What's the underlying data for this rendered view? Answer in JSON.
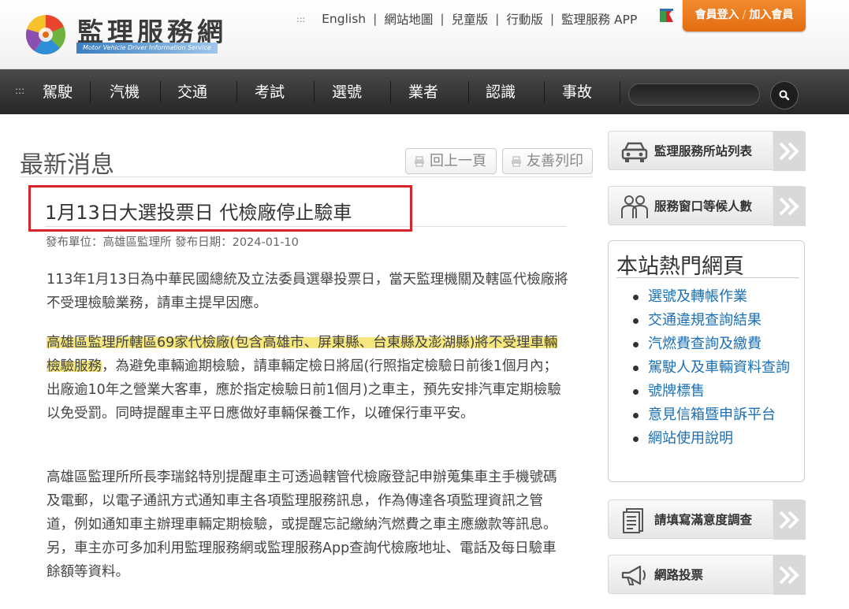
{
  "header": {
    "logo_title": "監理服務網",
    "logo_subtitle": "Motor Vehicle Driver Information Service",
    "toplinks": [
      "English",
      "網站地圖",
      "兒童版",
      "行動版",
      "監理服務 APP"
    ],
    "toplinks_marker": ":::",
    "login_label": "會員登入",
    "join_label": "加入會員",
    "brand_color": "#e46c10"
  },
  "nav": {
    "marker": ":::",
    "items": [
      "駕駛",
      "汽機",
      "交通",
      "考試",
      "選號",
      "業者",
      "認識",
      "事故"
    ],
    "search_placeholder": ""
  },
  "main": {
    "page_title": "最新消息",
    "back_label": "回上一頁",
    "print_label": "友善列印",
    "headline": "1月13日大選投票日 代檢廠停止驗車",
    "meta": "發布單位：高雄區監理所 發布日期：2024-01-10",
    "para1": "113年1月13日為中華民國總統及立法委員選舉投票日，當天監理機關及轄區代檢廠將不受理檢驗業務，請車主提早因應。",
    "para2_highlight": "高雄區監理所轄區69家代檢廠(包含高雄市、屏東縣、台東縣及澎湖縣)將不受理車輛檢驗服務",
    "para2_rest": "，為避免車輛逾期檢驗，請車輛定檢日將屆(行照指定檢驗日前後1個月內；出廠逾10年之營業大客車，應於指定檢驗日前1個月)之車主，預先安排汽車定期檢驗以免受罰。同時提醒車主平日應做好車輛保養工作，以確保行車平安。",
    "para3": "高雄區監理所所長李瑞銘特別提醒車主可透過轄管代檢廠登記申辦蒐集車主手機號碼及電郵，以電子通訊方式通知車主各項監理服務訊息，作為傳達各項監理資訊之管道，例如通知車主辦理車輛定期檢驗，或提醒忘記繳納汽燃費之車主應繳款等訊息。另，車主亦可多加利用監理服務網或監理服務App查詢代檢廠地址、電話及每日驗車餘額等資料。",
    "highlight_color": "#f6e77e",
    "outline_color": "#d9232a"
  },
  "sidebar": {
    "station_list": "監理服務所站列表",
    "queue": "服務窗口等候人數",
    "hot_title": "本站熱門網頁",
    "hot_links": [
      "選號及轉帳作業",
      "交通違規查詢結果",
      "汽燃費查詢及繳費",
      "駕駛人及車輛資料查詢",
      "號牌標售",
      "意見信箱暨申訴平台",
      "網站使用說明"
    ],
    "survey": "請填寫滿意度調查",
    "vote": "網路投票",
    "link_color": "#1a6fb5"
  }
}
